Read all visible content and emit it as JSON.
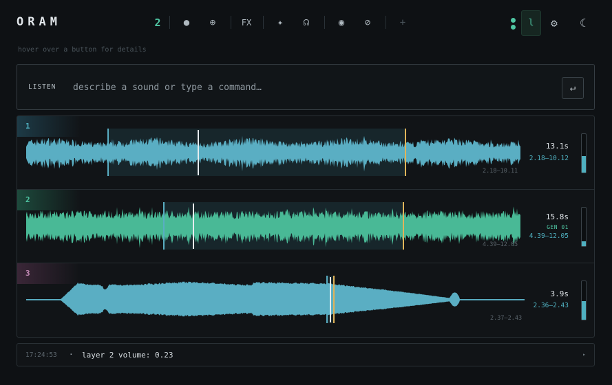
{
  "app": {
    "logo": "ORAM",
    "hint": "hover over a button for details"
  },
  "toolbar": {
    "layer_count": "2",
    "buttons": [
      {
        "name": "record-button",
        "glyph": "●"
      },
      {
        "name": "add-layer-button",
        "glyph": "⊕"
      },
      {
        "name": "fx-button",
        "glyph": "FX"
      },
      {
        "name": "sparkle-button",
        "glyph": "✦"
      },
      {
        "name": "listen-button",
        "glyph": "☊"
      },
      {
        "name": "target-button",
        "glyph": "◉"
      },
      {
        "name": "clear-button",
        "glyph": "⊘"
      },
      {
        "name": "plus-button",
        "glyph": "+"
      }
    ],
    "active_label": "l",
    "settings_glyph": "⚙",
    "theme_glyph": "☾"
  },
  "prompt": {
    "label": "LISTEN",
    "placeholder": "describe a sound or type a command…",
    "value": "",
    "submit_glyph": "↵"
  },
  "tracks": [
    {
      "num": "1",
      "duration": "13.1s",
      "gen": "",
      "range": "2.18–10.12",
      "range_small": "2.18–10.11",
      "volume": 0.43,
      "color": "#5aaec3",
      "num_color": "#4fb0c0",
      "tint": "#1d3a46"
    },
    {
      "num": "2",
      "duration": "15.8s",
      "gen": "GEN 01",
      "range": "4.39–12.05",
      "range_small": "4.39–12.05",
      "volume": 0.12,
      "color": "#49b996",
      "num_color": "#4fc6a3",
      "tint": "#1d4a3c"
    },
    {
      "num": "3",
      "duration": "3.9s",
      "gen": "",
      "range": "2.36–2.43",
      "range_small": "2.37–2.43",
      "volume": 0.48,
      "color": "#5aaec3",
      "num_color": "#c58bb7",
      "tint": "#3a2637"
    }
  ],
  "status": {
    "time": "17:24:53",
    "sep": "·",
    "message": "layer 2 volume: 0.23",
    "arrow_glyph": "▸"
  },
  "colors": {
    "accent": "#4fc6a3",
    "wave_blue": "#5aaec3",
    "wave_green": "#49b996",
    "marker_gold": "#e0b45a"
  }
}
